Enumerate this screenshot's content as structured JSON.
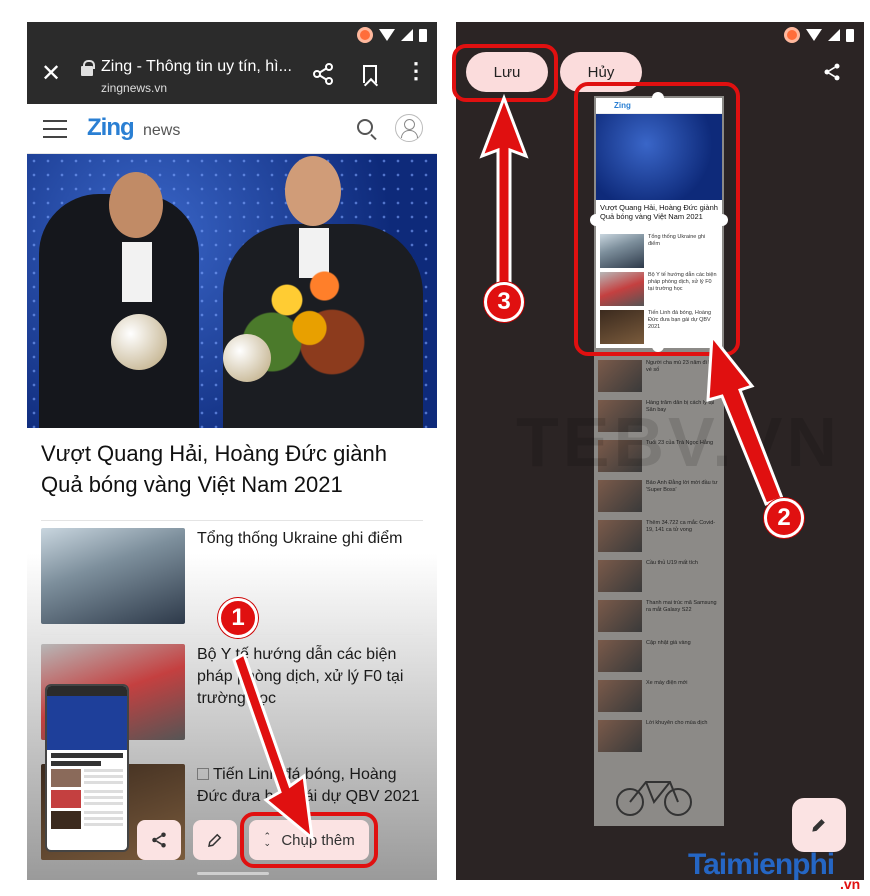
{
  "left_screen": {
    "browser": {
      "page_title": "Zing - Thông tin uy tín, hì...",
      "url": "zingnews.vn"
    },
    "site": {
      "logo": "Zing",
      "logo_suffix": "news"
    },
    "headline": "Vượt Quang Hải, Hoàng Đức giành Quả bóng vàng Việt Nam 2021",
    "articles": [
      {
        "title": "Tổng thống Ukraine ghi điểm"
      },
      {
        "title": "Bộ Y tế hướng dẫn các biện pháp phòng dịch, xử lý F0 tại trường học"
      },
      {
        "title": "Tiến Linh đá bóng, Hoàng Đức đưa bạn gái dự QBV 2021"
      }
    ],
    "toolbar": {
      "capture_more_label": "Chụp thêm"
    }
  },
  "right_screen": {
    "save_label": "Lưu",
    "cancel_label": "Hủy",
    "preview": {
      "logo": "Zing",
      "headline": "Vượt Quang Hải, Hoàng Đức giành Quả bóng vàng Việt Nam 2021",
      "rows": [
        "Tổng thống Ukraine ghi điểm",
        "Bộ Y tế hướng dẫn các biện pháp phòng dịch, xử lý F0 tại trường học",
        "Tiến Linh đá bóng, Hoàng Đức đưa bạn gái dự QBV 2021"
      ]
    },
    "long_rows": [
      "Người cha mù 23 năm đi bán vé số",
      "Hàng trăm dân bị cách ly tại Sân bay",
      "Tuổi 23 của Trà Ngọc Hằng",
      "Bảo Anh Đằng lời mời đầu tư 'Super Boss'",
      "Thêm 34.722 ca mắc Covid-19, 141 ca tử vong",
      "Cầu thủ U19 mất tích",
      "Thanh mai trúc mã Samsung ra mắt Galaxy S22",
      "Cập nhật giá vàng",
      "Xe máy điện mới",
      "Lời khuyên cho mùa dịch"
    ]
  },
  "annotations": {
    "step1": "1",
    "step2": "2",
    "step3": "3"
  },
  "watermark": {
    "brand": "Taimienphi",
    "suffix": ".vn"
  },
  "colors": {
    "annotation_red": "#e01010",
    "button_pink": "#fbe3e3",
    "zing_blue": "#2a7fd3"
  }
}
